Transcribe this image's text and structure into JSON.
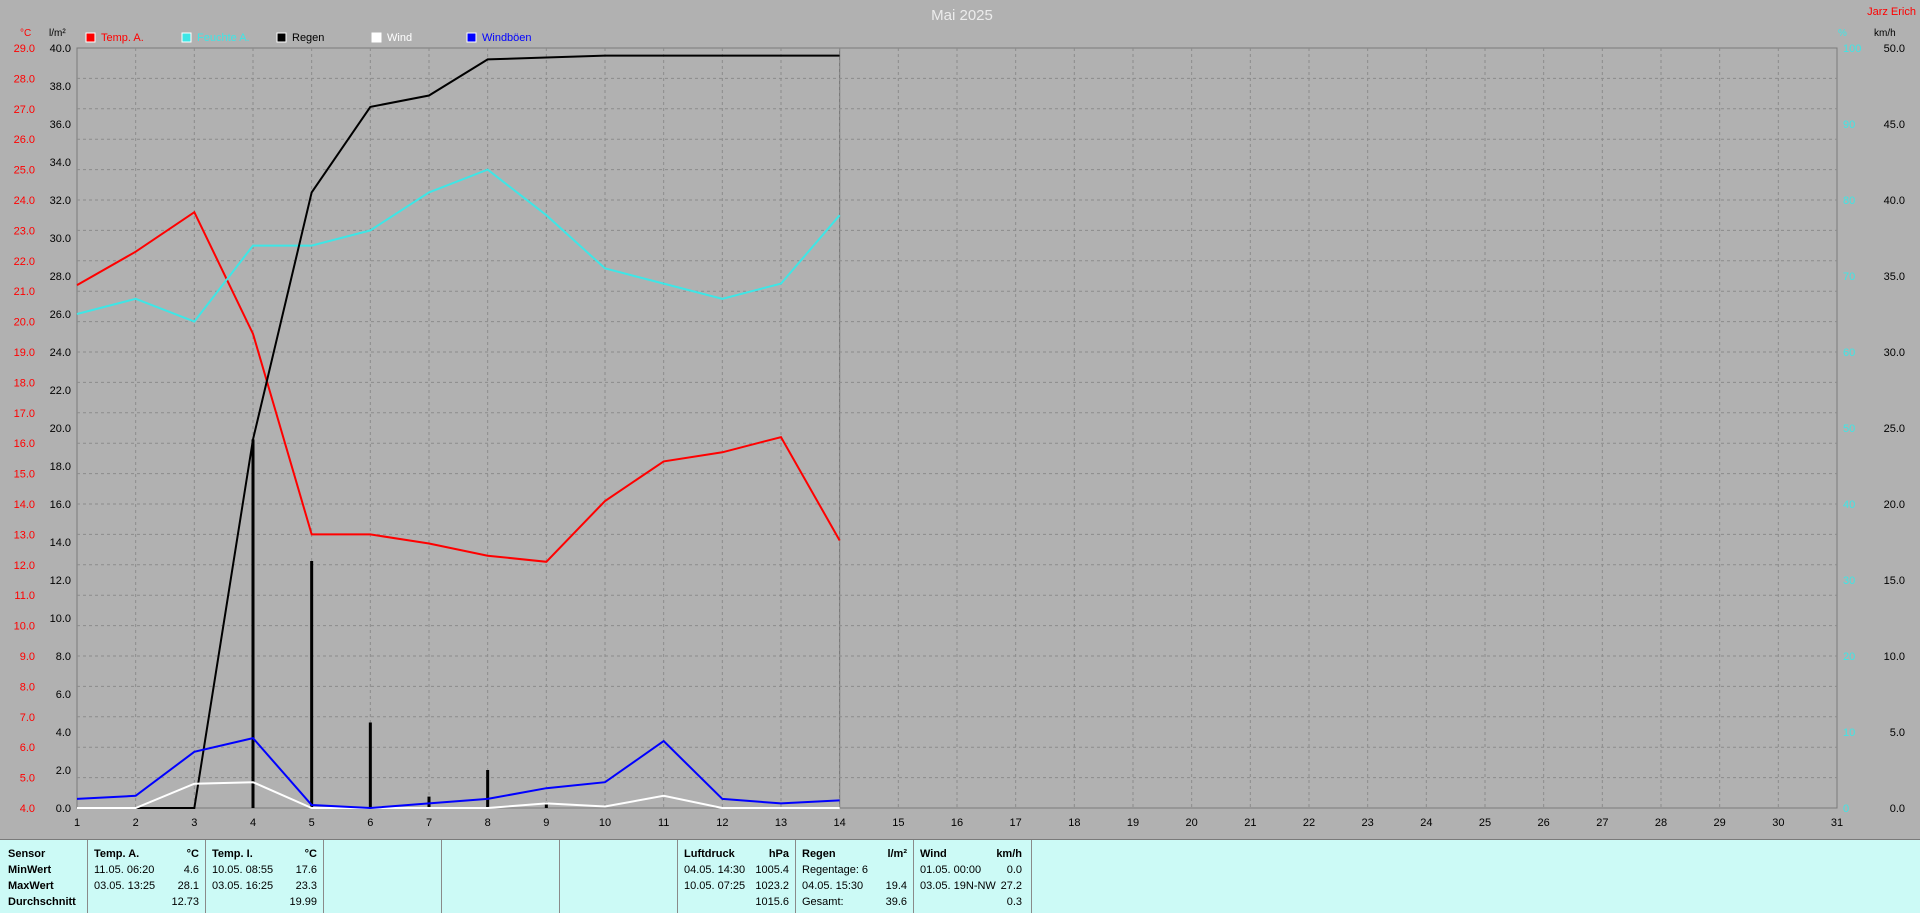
{
  "chart_data": {
    "type": "line",
    "title": "Mai 2025",
    "author": "Jarz Erich",
    "y_units": {
      "temp": "°C",
      "rain": "l/m²",
      "right_blank": "%",
      "wind": "km/h"
    },
    "temp_axis": {
      "range": [
        4.0,
        29.0
      ],
      "ticks": [
        "29.0",
        "28.0",
        "27.0",
        "26.0",
        "25.0",
        "24.0",
        "23.0",
        "22.0",
        "21.0",
        "20.0",
        "19.0",
        "18.0",
        "17.0",
        "16.0",
        "15.0",
        "14.0",
        "13.0",
        "12.0",
        "11.0",
        "10.0",
        "9.0",
        "8.0",
        "7.0",
        "6.0",
        "5.0",
        "4.0"
      ]
    },
    "rain_axis": {
      "range": [
        0.0,
        40.0
      ],
      "ticks": [
        "40.0",
        "38.0",
        "36.0",
        "34.0",
        "32.0",
        "30.0",
        "28.0",
        "26.0",
        "24.0",
        "22.0",
        "20.0",
        "18.0",
        "16.0",
        "14.0",
        "12.0",
        "10.0",
        "8.0",
        "6.0",
        "4.0",
        "2.0",
        "0.0"
      ]
    },
    "right_axis_cyan_ticks": [
      "100",
      "90",
      "80",
      "70",
      "60",
      "50",
      "40",
      "30",
      "20",
      "10",
      "0"
    ],
    "wind_axis": {
      "range": [
        0.0,
        50.0
      ],
      "ticks": [
        "50.0",
        "45.0",
        "40.0",
        "35.0",
        "30.0",
        "25.0",
        "20.0",
        "15.0",
        "10.0",
        "5.0",
        "0.0"
      ]
    },
    "x_ticks": [
      "1",
      "2",
      "3",
      "4",
      "5",
      "6",
      "7",
      "8",
      "9",
      "10",
      "11",
      "12",
      "13",
      "14",
      "15",
      "16",
      "17",
      "18",
      "19",
      "20",
      "21",
      "22",
      "23",
      "24",
      "25",
      "26",
      "27",
      "28",
      "29",
      "30",
      "31"
    ],
    "legend": [
      {
        "label": "Temp. A.",
        "color": "#ff0000"
      },
      {
        "label": "Feuchte A.",
        "color": "#3ee6e6"
      },
      {
        "label": "Regen",
        "color": "#000000"
      },
      {
        "label": "Wind",
        "color": "#ffffff"
      },
      {
        "label": "Windböen",
        "color": "#0000ff"
      }
    ],
    "series": [
      {
        "name": "Temp. A.",
        "color": "#ff0000",
        "axis": "temp",
        "x": [
          1,
          2,
          3,
          4,
          5,
          6,
          7,
          8,
          9,
          10,
          11,
          12,
          13,
          14
        ],
        "values": [
          21.2,
          22.3,
          23.6,
          19.6,
          13.0,
          13.0,
          12.7,
          12.3,
          12.1,
          14.1,
          15.4,
          15.7,
          16.2,
          12.8
        ]
      },
      {
        "name": "Feuchte A.",
        "color": "#3ee6e6",
        "axis": "right_blank",
        "x": [
          1,
          2,
          3,
          4,
          5,
          6,
          7,
          8,
          9,
          10,
          11,
          12,
          13,
          14
        ],
        "values": [
          65,
          67,
          64,
          74,
          74,
          76,
          81,
          84,
          78,
          71,
          69,
          67,
          69,
          78
        ]
      },
      {
        "name": "Regen",
        "color": "#000000",
        "axis": "rain",
        "x": [
          1,
          2,
          3,
          4,
          5,
          6,
          7,
          8,
          9,
          10,
          11,
          12,
          13,
          14
        ],
        "values": [
          0.0,
          0.0,
          0.0,
          19.4,
          32.4,
          36.9,
          37.5,
          39.4,
          39.5,
          39.6,
          39.6,
          39.6,
          39.6,
          39.6
        ]
      },
      {
        "name": "Wind",
        "color": "#ffffff",
        "axis": "wind",
        "x": [
          1,
          2,
          3,
          4,
          5,
          6,
          7,
          8,
          9,
          10,
          11,
          12,
          13,
          14
        ],
        "values": [
          0.0,
          0.0,
          1.6,
          1.7,
          0.0,
          0.0,
          0.0,
          0.0,
          0.3,
          0.1,
          0.8,
          0.0,
          0.0,
          0.0
        ]
      },
      {
        "name": "Windböen",
        "color": "#0000ff",
        "axis": "wind",
        "x": [
          1,
          2,
          3,
          4,
          5,
          6,
          7,
          8,
          9,
          10,
          11,
          12,
          13,
          14
        ],
        "values": [
          0.6,
          0.8,
          3.7,
          4.6,
          0.2,
          0.0,
          0.3,
          0.6,
          1.3,
          1.7,
          4.4,
          0.6,
          0.3,
          0.5
        ]
      }
    ],
    "daily_rain_bars": {
      "color": "#000000",
      "axis": "rain",
      "x": [
        4,
        5,
        6,
        7,
        8,
        9
      ],
      "values": [
        19.4,
        13.0,
        4.5,
        0.6,
        2.0,
        0.3
      ]
    }
  },
  "stats": {
    "sensor": {
      "header": "Sensor",
      "rows": [
        "MinWert",
        "MaxWert",
        "Durchschnitt"
      ]
    },
    "temp_a": {
      "header": "Temp. A.",
      "unit": "°C",
      "min": {
        "date": "11.05.  06:20",
        "value": "4.6"
      },
      "max": {
        "date": "03.05.  13:25",
        "value": "28.1"
      },
      "avg": "12.73"
    },
    "temp_i": {
      "header": "Temp. I.",
      "unit": "°C",
      "min": {
        "date": "10.05.  08:55",
        "value": "17.6"
      },
      "max": {
        "date": "03.05.  16:25",
        "value": "23.3"
      },
      "avg": "19.99"
    },
    "pressure": {
      "header": "Luftdruck",
      "unit": "hPa",
      "min": {
        "date": "04.05.  14:30",
        "value": "1005.4"
      },
      "max": {
        "date": "10.05.  07:25",
        "value": "1023.2"
      },
      "avg": "1015.6"
    },
    "rain": {
      "header": "Regen",
      "unit": "l/m²",
      "days_label": "Regentage: 6",
      "max": {
        "date": "04.05.  15:30",
        "value": "19.4"
      },
      "total_label": "Gesamt:",
      "total": "39.6"
    },
    "wind": {
      "header": "Wind",
      "unit": "km/h",
      "min": {
        "date": "01.05.  00:00",
        "value": "0.0"
      },
      "max": {
        "date": "03.05.  19N-NW",
        "value": "27.2"
      },
      "avg": "0.3"
    }
  }
}
